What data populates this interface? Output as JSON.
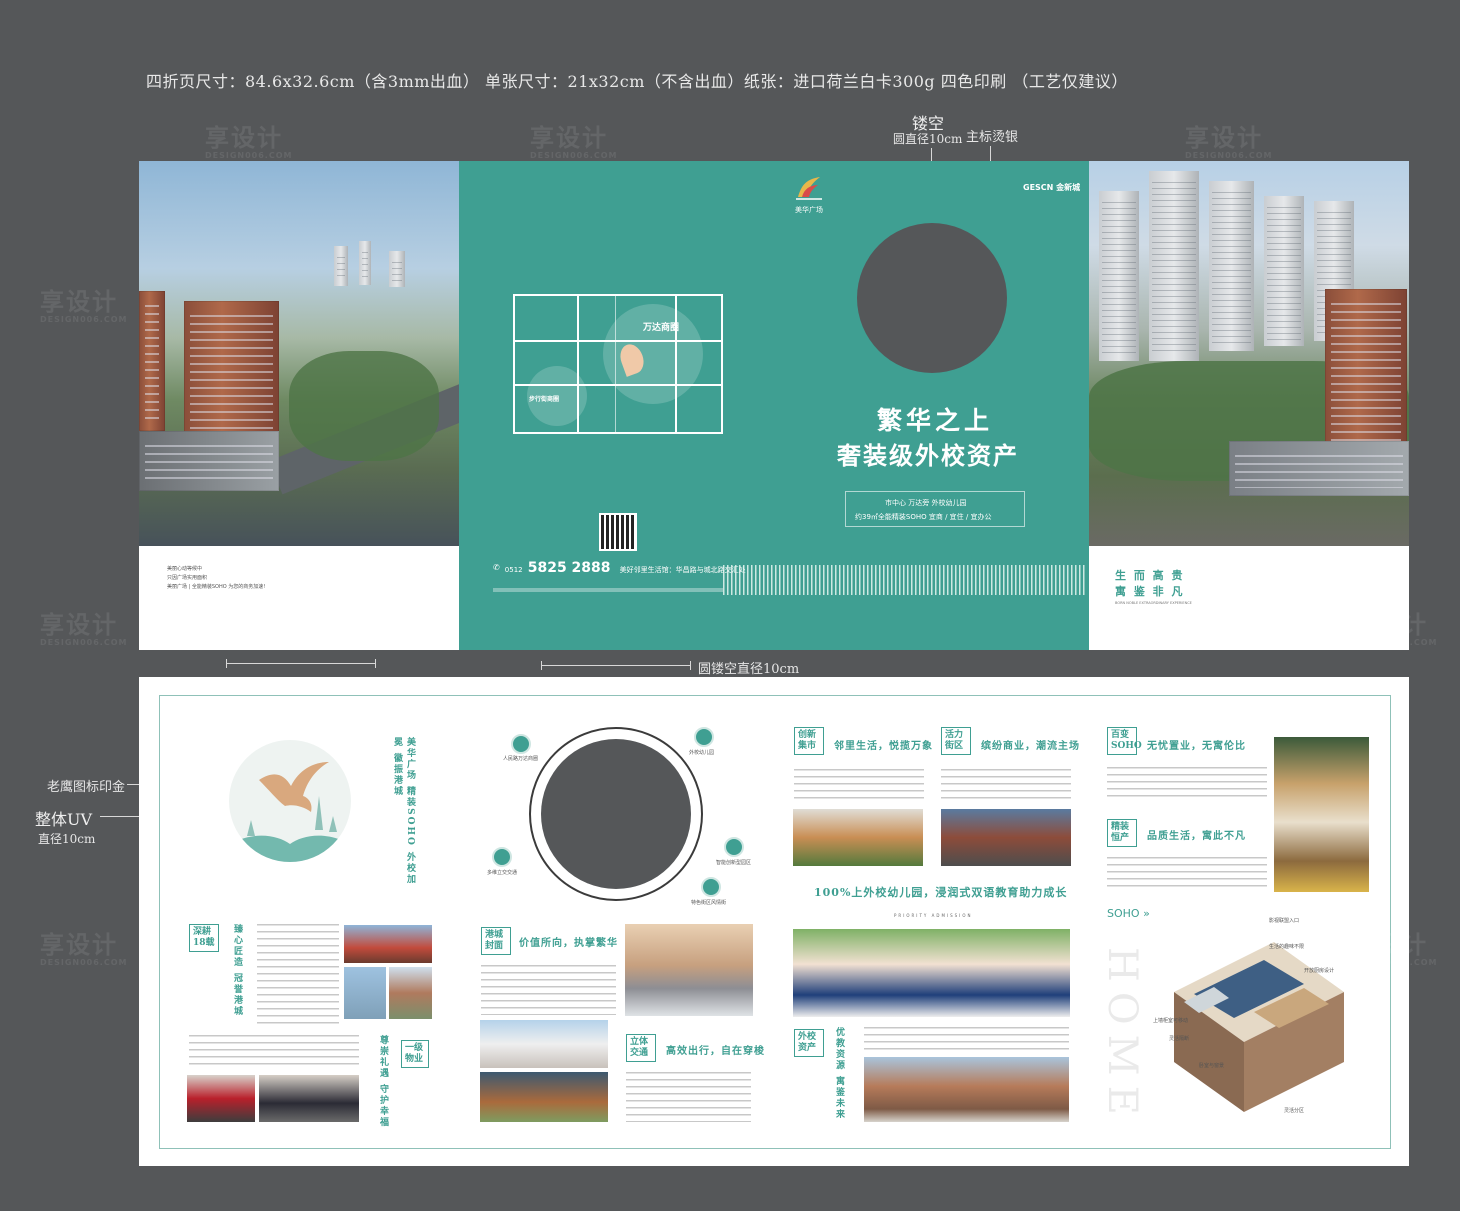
{
  "spec_text": "四折页尺寸：84.6x32.6cm（含3mm出血） 单张尺寸：21x32cm（不含出血）纸张：进口荷兰白卡300g 四色印刷 （工艺仅建议）",
  "watermark": {
    "main": "享设计",
    "sub": "DESIGN006.COM"
  },
  "annotations": {
    "hollow": "镂空",
    "hollow_diameter": "圆直径10cm",
    "logo_silver": "主标烫银",
    "round_hollow": "圆镂空直径10cm",
    "eagle_gold": "老鹰图标印金",
    "uv": "整体UV",
    "uv_diameter": "直径10cm"
  },
  "outer": {
    "left_caption": [
      "美丽心动等候中",
      "只因广场实用面积",
      "美丽广场 | 全能精装SOHO 为您的商务加速!"
    ],
    "project_logo": "美华广场",
    "gescn_logo": "GESCN 金新城",
    "map_labels": {
      "wanda": "万达商圈",
      "buxing": "步行街商圈"
    },
    "phone_prefix": "0512",
    "phone": "5825 2888",
    "address": "美好邻里生活馆：华昌路与城北路交汇处",
    "headline_1": "繁华之上",
    "headline_2": "奢装级外校资产",
    "sub_1": "市中心  万达旁  外校幼儿园",
    "sub_2": "约39㎡全能精装SOHO  宜商 / 宜住 / 宜办公",
    "right_slogan_1": "生 而 高 贵",
    "right_slogan_2": "寓 鉴 非 凡",
    "right_slogan_en": "BORN NOBLE  EXTRAORDINARY EXPERIENCE"
  },
  "inner": {
    "vertical_slogan_1": "美华广场 精装SOHO 外校加冕 徽振港城",
    "icons": [
      "人民路万达商圈",
      "外校幼儿园",
      "多维立交交通",
      "智能创新型园区",
      "特色街区风情街"
    ],
    "sec_a_badge": "深耕18载",
    "sec_a_vert": "臻心匠造 冠誉港城",
    "sec_b_badge": "一级物业",
    "sec_b_vert": "尊崇礼遇 守护幸福",
    "sec_c_badge": "港城封面",
    "sec_c_head": "价值所向，执掌繁华",
    "sec_d_badge": "立体交通",
    "sec_d_head": "高效出行，自在穿梭",
    "sec_e_badge": "创新集市",
    "sec_e_head": "邻里生活，悦揽万象",
    "sec_f_badge": "活力街区",
    "sec_f_head": "缤纷商业，潮流主场",
    "edu_head": "100%上外校幼儿园，浸润式双语教育助力成长",
    "edu_en": "PRIORITY ADMISSION",
    "sec_g_badge": "外校资产",
    "sec_g_vert": "优教资源 寓鉴未来",
    "sec_h_badge": "百变SOHO",
    "sec_h_head": "无忧置业，无寓伦比",
    "sec_i_badge": "精装恒产",
    "sec_i_head": "品质生活，寓此不凡",
    "soho_tag": "SOHO »",
    "home_word": "HOME",
    "plan_notes": [
      "影视联盟入口",
      "生活的趣味不限",
      "开放厨房设计",
      "上墙柜室可移动",
      "灵活隔断",
      "卧室与窗景",
      "灵活分区"
    ]
  }
}
